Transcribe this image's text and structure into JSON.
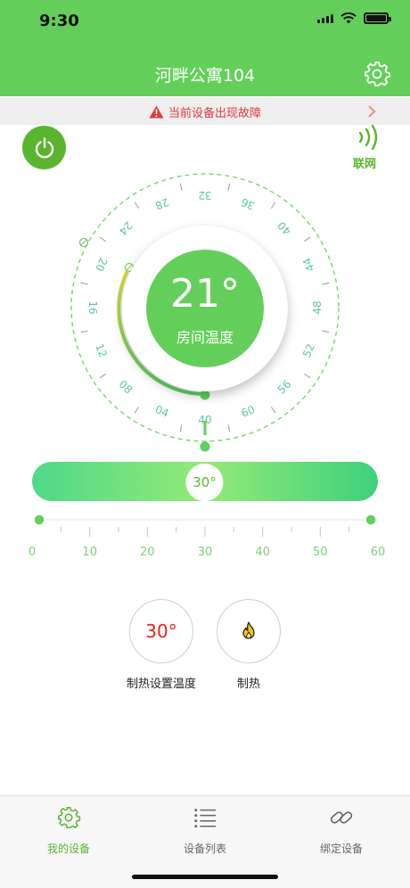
{
  "status_bar": {
    "time": "9:30"
  },
  "header": {
    "title": "河畔公寓104",
    "settings_icon": "gear-icon"
  },
  "fault_banner": {
    "icon": "warning-triangle-icon",
    "message": "当前设备出现故障",
    "chevron_icon": "chevron-right-icon"
  },
  "controls": {
    "power_icon": "power-icon",
    "network_icon": "signal-waves-icon",
    "network_label": "联网"
  },
  "dial": {
    "scale_labels": [
      "40",
      "04",
      "08",
      "12",
      "16",
      "20",
      "24",
      "28",
      "32",
      "36",
      "40",
      "44",
      "48",
      "52",
      "56",
      "60"
    ],
    "room_temperature": "21°",
    "room_temperature_label": "房间温度"
  },
  "slider": {
    "value": "30°",
    "ruler_labels": [
      "0",
      "10",
      "20",
      "30",
      "40",
      "50",
      "60"
    ]
  },
  "actions": [
    {
      "value": "30°",
      "label": "制热设置温度"
    },
    {
      "icon": "flame-icon",
      "label": "制热"
    }
  ],
  "tabs": [
    {
      "label": "我的设备",
      "icon": "gear-icon",
      "active": true
    },
    {
      "label": "设备列表",
      "icon": "list-icon",
      "active": false
    },
    {
      "label": "绑定设备",
      "icon": "link-icon",
      "active": false
    }
  ],
  "colors": {
    "primary": "#63cf5a",
    "accent_green": "#5ab52e",
    "alert_red": "#e23b3b",
    "set_temp_red": "#e8201e"
  }
}
